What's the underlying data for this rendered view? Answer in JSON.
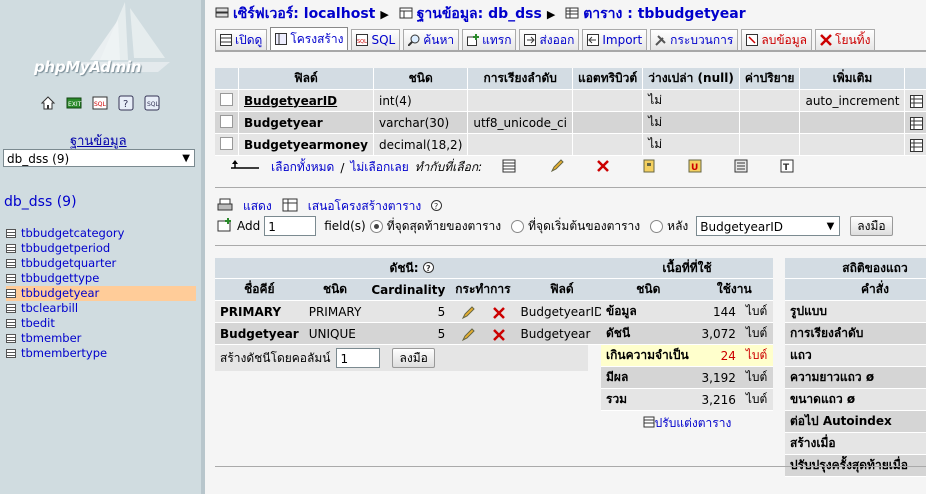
{
  "colors": {
    "left_bg": "#d0dce0",
    "header_bg": "#d3dce3",
    "row_light": "#e5e5e5",
    "row_dark": "#d5d5d5",
    "link": "#0000cc",
    "active_table": "#ffcc99",
    "highlight": "#ffffcc"
  },
  "left": {
    "logo_text": "phpMyAdmin",
    "nav_icons": [
      "home-icon",
      "exit-icon",
      "sql-icon",
      "query-icon",
      "docs-icon"
    ],
    "db_label": "ฐานข้อมูล",
    "db_selected": "db_dss (9)",
    "db_title": "db_dss (9)",
    "tables": [
      "tbbudgetcategory",
      "tbbudgetperiod",
      "tbbudgetquarter",
      "tbbudgettype",
      "tbbudgetyear",
      "tbclearbill",
      "tbedit",
      "tbmember",
      "tbmembertype"
    ],
    "active_table_index": 4
  },
  "breadcrumb": {
    "server": "เซิร์ฟเวอร์: localhost",
    "database": "ฐานข้อมูล: db_dss",
    "table": "ตาราง : tbbudgetyear"
  },
  "tabs": [
    {
      "label": "เปิดดู",
      "icon": "browse-icon"
    },
    {
      "label": "โครงสร้าง",
      "icon": "structure-icon",
      "active": true
    },
    {
      "label": "SQL",
      "icon": "sql-icon"
    },
    {
      "label": "ค้นหา",
      "icon": "search-icon"
    },
    {
      "label": "แทรก",
      "icon": "insert-icon"
    },
    {
      "label": "ส่งออก",
      "icon": "export-icon"
    },
    {
      "label": "Import",
      "icon": "import-icon"
    },
    {
      "label": "กระบวนการ",
      "icon": "operations-icon"
    },
    {
      "label": "ลบข้อมูล",
      "icon": "empty-icon",
      "danger": true
    },
    {
      "label": "โยนทิ้ง",
      "icon": "drop-icon",
      "danger": true
    }
  ],
  "fields_table": {
    "headers": [
      "ฟิลด์",
      "ชนิด",
      "การเรียงลำดับ",
      "แอตทริบิวต์",
      "ว่างเปล่า (null)",
      "ค่าปริยาย",
      "เพิ่มเติม"
    ],
    "rows": [
      {
        "name": "BudgetyearID",
        "type": "int(4)",
        "collation": "",
        "attributes": "",
        "null": "ไม่",
        "default": "",
        "extra": "auto_increment",
        "primary": true
      },
      {
        "name": "Budgetyear",
        "type": "varchar(30)",
        "collation": "utf8_unicode_ci",
        "attributes": "",
        "null": "ไม่",
        "default": "",
        "extra": ""
      },
      {
        "name": "Budgetyearmoney",
        "type": "decimal(18,2)",
        "collation": "",
        "attributes": "",
        "null": "ไม่",
        "default": "",
        "extra": ""
      }
    ]
  },
  "selection": {
    "check_all": "เลือกทั้งหมด",
    "separator": " / ",
    "uncheck_all": "ไม่เลือกเลย",
    "with_selected": "ทำกับที่เลือก:"
  },
  "print_view": "แสดง",
  "propose_structure": "เสนอโครงสร้างตาราง",
  "add_field": {
    "add_label": "Add",
    "count": "1",
    "fields_label": "field(s)",
    "at_end": "ที่จุดสุดท้ายของตาราง",
    "at_begin": "ที่จุดเริ่มต้นของตาราง",
    "after": "หลัง",
    "after_field": "BudgetyearID",
    "go": "ลงมือ"
  },
  "indexes": {
    "title": "ดัชนี:",
    "headers": [
      "ชื่อคีย์",
      "ชนิด",
      "Cardinality",
      "กระทำการ",
      "ฟิลด์"
    ],
    "rows": [
      {
        "key": "PRIMARY",
        "type": "PRIMARY",
        "cardinality": "5",
        "field": "BudgetyearID"
      },
      {
        "key": "Budgetyear",
        "type": "UNIQUE",
        "cardinality": "5",
        "field": "Budgetyear"
      }
    ],
    "create_label": "สร้างดัชนีโดยคอลัมน์",
    "create_count": "1",
    "go": "ลงมือ"
  },
  "space_usage": {
    "title": "เนื้อที่ที่ใช้",
    "headers": [
      "ชนิด",
      "ใช้งาน"
    ],
    "rows": [
      {
        "type": "ข้อมูล",
        "value": "144",
        "unit": "ไบต์"
      },
      {
        "type": "ดัชนี",
        "value": "3,072",
        "unit": "ไบต์"
      },
      {
        "type": "เกินความจำเป็น",
        "value": "24",
        "unit": "ไบต์",
        "highlight": true
      },
      {
        "type": "มีผล",
        "value": "3,192",
        "unit": "ไบต์"
      },
      {
        "type": "รวม",
        "value": "3,216",
        "unit": "ไบต์"
      }
    ],
    "optimize": "ปรับแต่งตาราง"
  },
  "row_stats": {
    "title": "สถิติของแถว",
    "header": "คำสั่ง",
    "rows": [
      "รูปแบบ",
      "การเรียงลำดับ",
      "แถว",
      "ความยาวแถว ø",
      "ขนาดแถว ø",
      "ต่อไป Autoindex",
      "สร้างเมื่อ",
      "ปรับปรุงครั้งสุดท้ายเมื่อ"
    ]
  }
}
